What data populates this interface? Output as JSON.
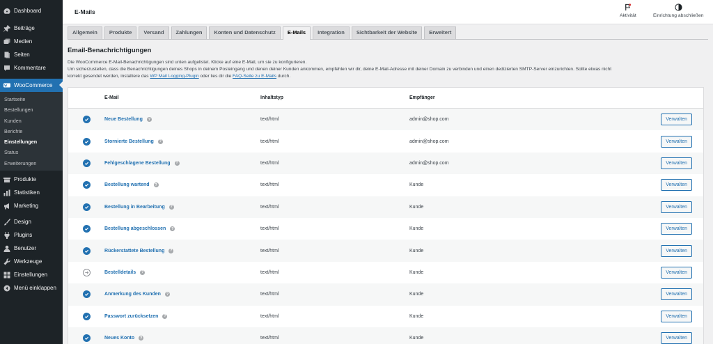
{
  "sidebar": {
    "top": [
      {
        "label": "Dashboard",
        "icon": "dashboard-icon"
      }
    ],
    "group1": [
      {
        "label": "Beiträge",
        "icon": "pin-icon"
      },
      {
        "label": "Medien",
        "icon": "media-icon"
      },
      {
        "label": "Seiten",
        "icon": "pages-icon"
      },
      {
        "label": "Kommentare",
        "icon": "comment-icon"
      }
    ],
    "woocommerce": {
      "label": "WooCommerce",
      "icon": "woo-icon"
    },
    "submenu": [
      "Startseite",
      "Bestellungen",
      "Kunden",
      "Berichte",
      "Einstellungen",
      "Status",
      "Erweiterungen"
    ],
    "submenu_current": "Einstellungen",
    "group2": [
      {
        "label": "Produkte",
        "icon": "box-icon"
      },
      {
        "label": "Statistiken",
        "icon": "bar-chart-icon"
      },
      {
        "label": "Marketing",
        "icon": "megaphone-icon"
      }
    ],
    "group3": [
      {
        "label": "Design",
        "icon": "brush-icon"
      },
      {
        "label": "Plugins",
        "icon": "plug-icon"
      },
      {
        "label": "Benutzer",
        "icon": "user-icon"
      },
      {
        "label": "Werkzeuge",
        "icon": "wrench-icon"
      },
      {
        "label": "Einstellungen",
        "icon": "settings-icon"
      },
      {
        "label": "Menü einklappen",
        "icon": "collapse-icon"
      }
    ]
  },
  "header": {
    "title": "E-Mails",
    "activity_label": "Aktivität",
    "setup_label": "Einrichtung abschließen"
  },
  "tabs": [
    "Allgemein",
    "Produkte",
    "Versand",
    "Zahlungen",
    "Konten und Datenschutz",
    "E-Mails",
    "Integration",
    "Sichtbarkeit der Website",
    "Erweitert"
  ],
  "active_tab": "E-Mails",
  "section": {
    "title": "Email-Benachrichtigungen",
    "line1": "Die WooCommerce E-Mail-Benachrichtigungen sind unten aufgelistet. Klicke auf eine E-Mail, um sie zu konfigurieren.",
    "line2": "Um sicherzustellen, dass die Benachrichtigungen deines Shops in deinem Posteingang und denen deiner Kunden ankommen, empfehlen wir dir, deine E-Mail-Adresse mit deiner Domain zu verbinden und einen dedizierten SMTP-Server einzurichten. Sollte etwas nicht",
    "line3_pre": "korrekt gesendet werden, installiere das ",
    "link1": "WP Mail Logging-Plugin",
    "line3_mid": " oder lies dir die ",
    "link2": "FAQ-Seite zu E-Mails",
    "line3_post": " durch."
  },
  "table": {
    "headers": {
      "email": "E-Mail",
      "type": "Inhaltstyp",
      "recipient": "Empfänger"
    },
    "rows": [
      {
        "name": "Neue Bestellung",
        "type": "text/html",
        "recipient": "admin@shop.com",
        "status": "enabled",
        "action": "Verwalten"
      },
      {
        "name": "Stornierte Bestellung",
        "type": "text/html",
        "recipient": "admin@shop.com",
        "status": "enabled",
        "action": "Verwalten"
      },
      {
        "name": "Fehlgeschlagene Bestellung",
        "type": "text/html",
        "recipient": "admin@shop.com",
        "status": "enabled",
        "action": "Verwalten"
      },
      {
        "name": "Bestellung wartend",
        "type": "text/html",
        "recipient": "Kunde",
        "status": "enabled",
        "action": "Verwalten"
      },
      {
        "name": "Bestellung in Bearbeitung",
        "type": "text/html",
        "recipient": "Kunde",
        "status": "enabled",
        "action": "Verwalten"
      },
      {
        "name": "Bestellung abgeschlossen",
        "type": "text/html",
        "recipient": "Kunde",
        "status": "enabled",
        "action": "Verwalten"
      },
      {
        "name": "Rückerstattete Bestellung",
        "type": "text/html",
        "recipient": "Kunde",
        "status": "enabled",
        "action": "Verwalten"
      },
      {
        "name": "Bestelldetails",
        "type": "text/html",
        "recipient": "Kunde",
        "status": "manual",
        "action": "Verwalten"
      },
      {
        "name": "Anmerkung des Kunden",
        "type": "text/html",
        "recipient": "Kunde",
        "status": "enabled",
        "action": "Verwalten"
      },
      {
        "name": "Passwort zurücksetzen",
        "type": "text/html",
        "recipient": "Kunde",
        "status": "enabled",
        "action": "Verwalten"
      },
      {
        "name": "Neues Konto",
        "type": "text/html",
        "recipient": "Kunde",
        "status": "enabled",
        "action": "Verwalten"
      }
    ]
  }
}
